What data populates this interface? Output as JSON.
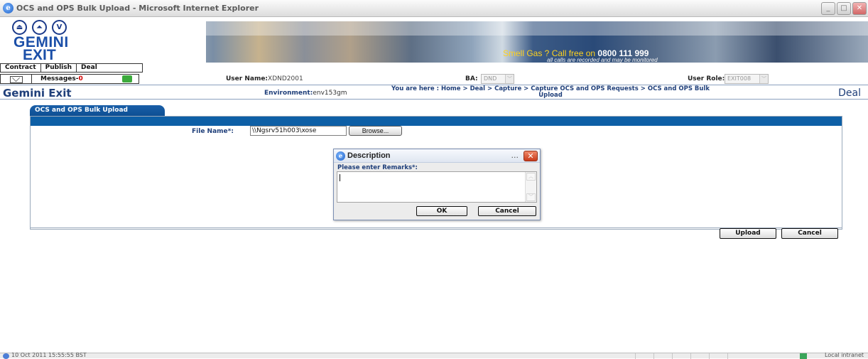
{
  "window": {
    "title": "OCS and OPS Bulk Upload - Microsoft Internet Explorer",
    "ie_icon": "e",
    "minimize": "_",
    "maximize": "□",
    "close": "✕"
  },
  "header": {
    "nav_circles": [
      "⏏",
      "⏶",
      "V"
    ],
    "logo_line1": "GEMINI",
    "logo_line2": "EXIT",
    "gas_prefix": "Smell Gas ? Call free on ",
    "gas_number": "0800 111 999",
    "gas_note": "all calls are recorded and may be monitored"
  },
  "menu": [
    "Contract",
    "Publish",
    "Deal"
  ],
  "info": {
    "messages_label": "Messages-",
    "messages_count": "0",
    "user_name_label": "User Name:",
    "user_name": "XDND2001",
    "ba_label": "BA:",
    "ba_value": "DND",
    "user_role_label": "User Role:",
    "user_role": "EXIT008"
  },
  "subheader": {
    "title": "Gemini Exit",
    "environment_label": "Environment:",
    "environment": "env153gm",
    "breadcrumb": "You are here : Home > Deal > Capture > Capture OCS and OPS Requests > OCS and OPS Bulk Upload",
    "section": "Deal"
  },
  "panel": {
    "tab": "OCS and OPS Bulk Upload",
    "file_label": "File Name*:",
    "file_value": "\\\\Ngsrv51h003\\xose",
    "browse": "Browse...",
    "upload": "Upload",
    "cancel": "Cancel"
  },
  "dialog": {
    "title": "Description",
    "dots": "...",
    "close": "✕",
    "prompt": "Please enter Remarks*:",
    "ok": "OK",
    "cancel": "Cancel"
  },
  "statusbar": {
    "text": "10 Oct 2011 15:55:55 BST",
    "zone": "Local intranet"
  }
}
